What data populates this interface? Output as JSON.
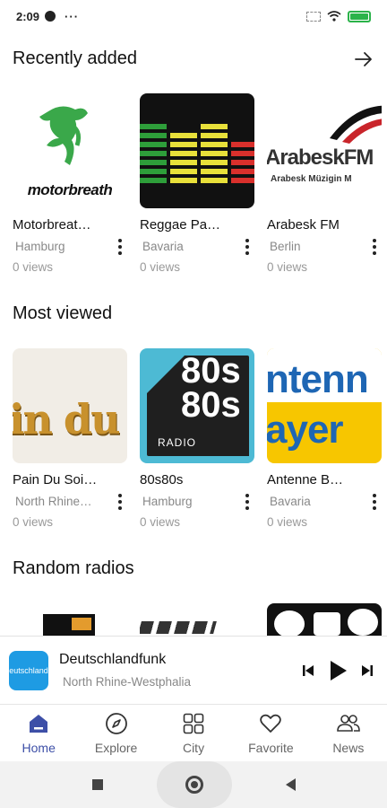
{
  "status_bar": {
    "time": "2:09",
    "more": "···"
  },
  "recently_added": {
    "title": "Recently added",
    "items": [
      {
        "name": "Motorbreat…",
        "region": "Hamburg",
        "views": "0 views",
        "logo": "motorbreath"
      },
      {
        "name": "Reggae Pa…",
        "region": "Bavaria",
        "views": "0 views"
      },
      {
        "name": "Arabesk FM",
        "region": "Berlin",
        "views": "0 views",
        "logo": "ArabeskFM",
        "logo_sub": "Arabesk Müzigin M"
      }
    ]
  },
  "most_viewed": {
    "title": "Most viewed",
    "items": [
      {
        "name": "Pain Du Soi…",
        "region": "North Rhine…",
        "views": "0 views",
        "logo": "in du s"
      },
      {
        "name": "80s80s",
        "region": "Hamburg",
        "views": "0 views",
        "logo_line1": "80s",
        "logo_line2": "80s",
        "logo_tag": "RADIO"
      },
      {
        "name": "Antenne B…",
        "region": "Bavaria",
        "views": "0 views",
        "logo_line1": "ntenn",
        "logo_line2": "ayer"
      }
    ]
  },
  "random_radios": {
    "title": "Random radios"
  },
  "now_playing": {
    "title": "Deutschlandfunk",
    "subtitle": "North Rhine-Westphalia",
    "thumb_text": "eutschland"
  },
  "nav": {
    "items": [
      {
        "label": "Home",
        "icon": "home-icon",
        "active": true
      },
      {
        "label": "Explore",
        "icon": "compass-icon"
      },
      {
        "label": "City",
        "icon": "grid-icon"
      },
      {
        "label": "Favorite",
        "icon": "heart-icon"
      },
      {
        "label": "News",
        "icon": "people-icon"
      }
    ]
  },
  "colors": {
    "accent": "#3d4fa7",
    "battery": "#2bb34a",
    "np_thumb": "#1e9be3"
  }
}
